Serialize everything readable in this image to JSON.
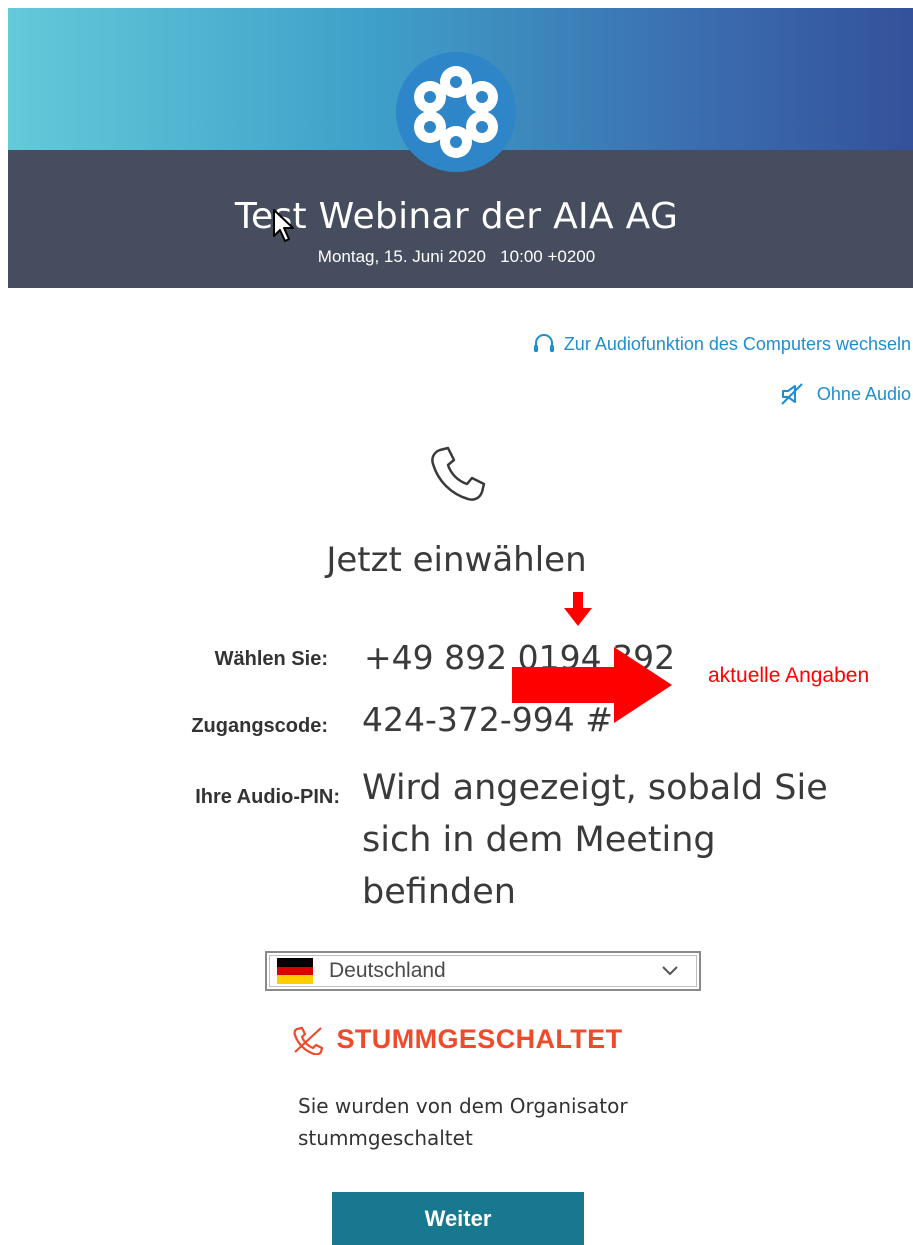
{
  "header": {
    "title": "Test Webinar der AIA AG",
    "subtitle": "Montag, 15. Juni 2020   10:00 +0200",
    "logo_icon": "flower-logo-icon"
  },
  "links": {
    "computer_audio": "Zur Audiofunktion des Computers wechseln",
    "no_audio": "Ohne Audio"
  },
  "dialin": {
    "title": "Jetzt einwählen",
    "dial_label": "Wählen Sie:",
    "dial_value": "+49 892 0194 392",
    "code_label": "Zugangscode:",
    "code_value": "424-372-994 #",
    "pin_label": "Ihre Audio-PIN:",
    "pin_value": "Wird angezeigt, sobald Sie sich in dem Meeting befinden"
  },
  "annotation": {
    "text": "aktuelle Angaben",
    "color": "#ff0000"
  },
  "country": {
    "selected": "Deutschland"
  },
  "status": {
    "muted": "STUMMGESCHALTET",
    "muted_info": "Sie wurden von dem Organisator stummgeschaltet"
  },
  "actions": {
    "continue": "Weiter"
  },
  "colors": {
    "accent_link": "#1f8ecf",
    "muted": "#ef4b2a",
    "button": "#17788f",
    "header_dark": "#454d5e"
  }
}
